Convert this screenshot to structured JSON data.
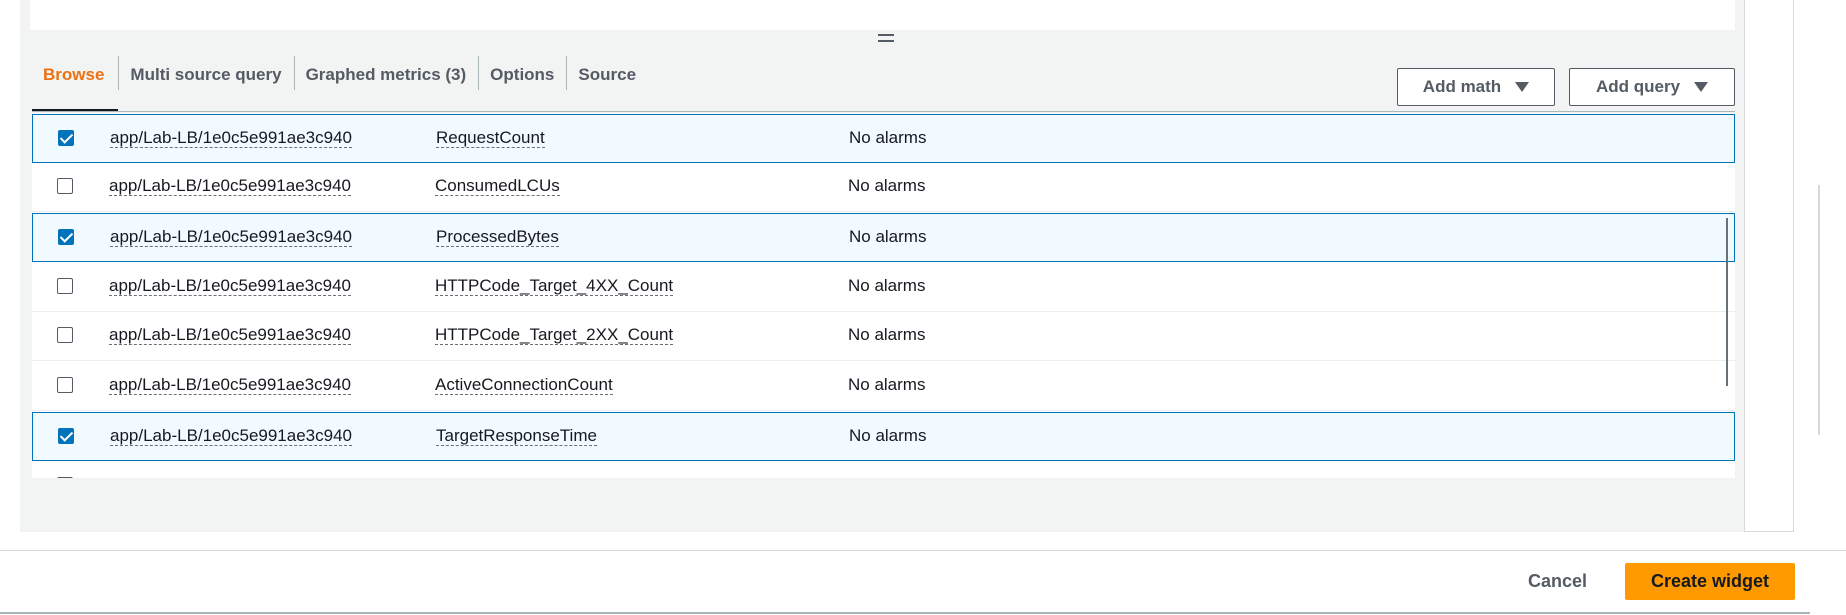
{
  "tabs": [
    {
      "label": "Browse",
      "active": true
    },
    {
      "label": "Multi source query",
      "active": false
    },
    {
      "label": "Graphed metrics (3)",
      "active": false
    },
    {
      "label": "Options",
      "active": false
    },
    {
      "label": "Source",
      "active": false
    }
  ],
  "toolbar": {
    "add_math_label": "Add math",
    "add_query_label": "Add query"
  },
  "rows": [
    {
      "checked": true,
      "load_balancer": "app/Lab-LB/1e0c5e991ae3c940",
      "metric": "RequestCount",
      "alarms": "No alarms"
    },
    {
      "checked": false,
      "load_balancer": "app/Lab-LB/1e0c5e991ae3c940",
      "metric": "ConsumedLCUs",
      "alarms": "No alarms"
    },
    {
      "checked": true,
      "load_balancer": "app/Lab-LB/1e0c5e991ae3c940",
      "metric": "ProcessedBytes",
      "alarms": "No alarms"
    },
    {
      "checked": false,
      "load_balancer": "app/Lab-LB/1e0c5e991ae3c940",
      "metric": "HTTPCode_Target_4XX_Count",
      "alarms": "No alarms"
    },
    {
      "checked": false,
      "load_balancer": "app/Lab-LB/1e0c5e991ae3c940",
      "metric": "HTTPCode_Target_2XX_Count",
      "alarms": "No alarms"
    },
    {
      "checked": false,
      "load_balancer": "app/Lab-LB/1e0c5e991ae3c940",
      "metric": "ActiveConnectionCount",
      "alarms": "No alarms"
    },
    {
      "checked": true,
      "load_balancer": "app/Lab-LB/1e0c5e991ae3c940",
      "metric": "TargetResponseTime",
      "alarms": "No alarms"
    }
  ],
  "footer": {
    "cancel_label": "Cancel",
    "create_label": "Create widget"
  },
  "colors": {
    "accent": "#ec7211",
    "primary_button": "#ff9900",
    "selected_row_border": "#0073bb",
    "selected_row_bg": "#f1faff"
  }
}
